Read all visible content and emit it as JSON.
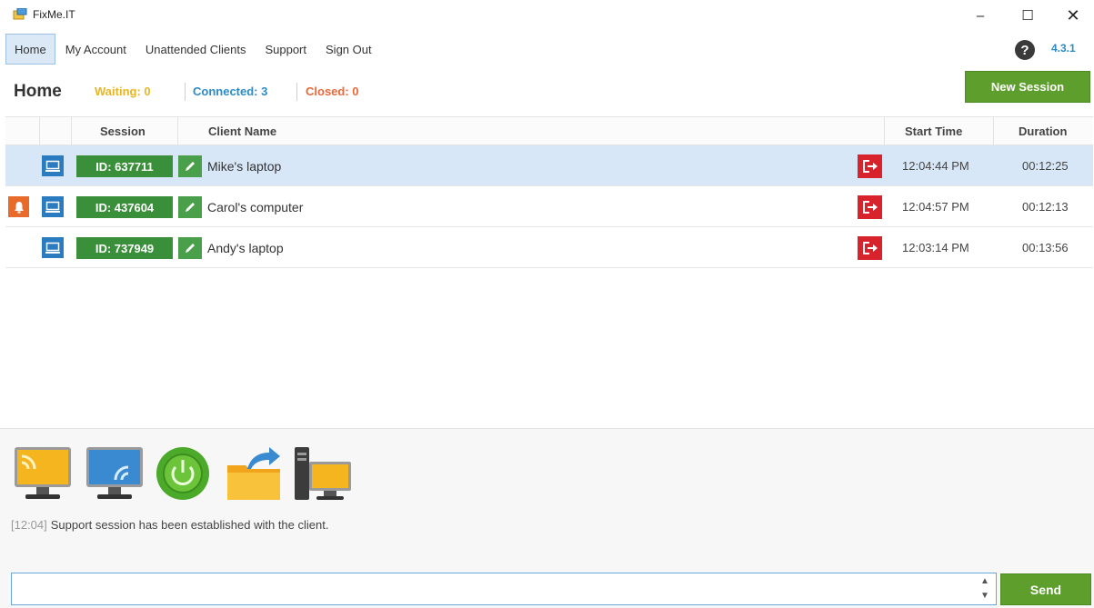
{
  "window": {
    "title": "FixMe.IT",
    "controls": {
      "minimize": "–",
      "maximize": "☐",
      "close": "✕"
    }
  },
  "menu": {
    "items": [
      {
        "label": "Home",
        "active": true
      },
      {
        "label": "My Account",
        "active": false
      },
      {
        "label": "Unattended Clients",
        "active": false
      },
      {
        "label": "Support",
        "active": false
      },
      {
        "label": "Sign Out",
        "active": false
      }
    ],
    "help_icon": "question-circle-icon",
    "help_glyph": "?",
    "version": "4.3.1"
  },
  "status": {
    "page_title": "Home",
    "waiting": "Waiting: 0",
    "connected": "Connected: 3",
    "closed": "Closed: 0",
    "colors": {
      "waiting": "#e8b623",
      "connected": "#2a8bc6",
      "closed": "#e8683a"
    }
  },
  "new_session_label": "New Session",
  "table": {
    "columns": {
      "session": "Session",
      "client": "Client Name",
      "start": "Start Time",
      "duration": "Duration"
    },
    "rows": [
      {
        "id": "ID: 637711",
        "client": "Mike's laptop",
        "start": "12:04:44 PM",
        "duration": "00:12:25",
        "selected": true,
        "alert": false
      },
      {
        "id": "ID: 437604",
        "client": "Carol's computer",
        "start": "12:04:57 PM",
        "duration": "00:12:13",
        "selected": false,
        "alert": true
      },
      {
        "id": "ID: 737949",
        "client": "Andy's laptop",
        "start": "12:03:14 PM",
        "duration": "00:13:56",
        "selected": false,
        "alert": false
      }
    ]
  },
  "tools": [
    {
      "icon": "remote-desktop-icon"
    },
    {
      "icon": "remote-screen-wireless-icon"
    },
    {
      "icon": "power-icon"
    },
    {
      "icon": "file-transfer-icon"
    },
    {
      "icon": "system-info-icon"
    }
  ],
  "log": {
    "time": "[12:04]",
    "message": "Support session has been established with the client."
  },
  "chat": {
    "value": "",
    "send_label": "Send"
  },
  "colors": {
    "accent_green": "#5e9e2d",
    "session_green": "#3a8f3a",
    "selection_blue": "#d8e7f8",
    "exit_red": "#d8222c"
  }
}
